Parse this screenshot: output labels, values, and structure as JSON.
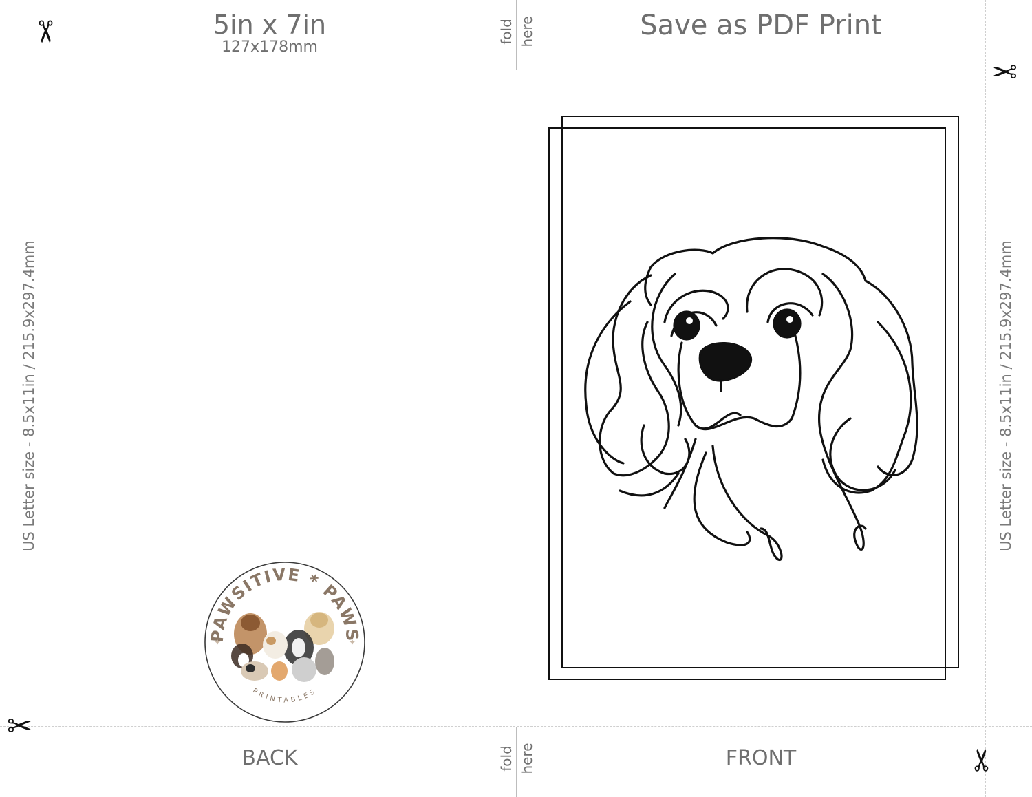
{
  "header": {
    "size_label": "5in x 7in",
    "size_metric": "127x178mm",
    "fold_word_1": "fold",
    "fold_word_2": "here",
    "title": "Save as PDF Print"
  },
  "side_label": "US Letter size - 8.5x11in / 215.9x297.4mm",
  "footer": {
    "back_label": "BACK",
    "front_label": "FRONT",
    "fold_word_1": "fold",
    "fold_word_2": "here"
  },
  "logo": {
    "brand_top": "PAWSITIVE * PAWS",
    "brand_bottom": "PRINTABLES",
    "brand_color": "#8a7766"
  },
  "icons": {
    "scissors": "scissors-icon",
    "dog": "cavalier-spaniel-line-art"
  }
}
